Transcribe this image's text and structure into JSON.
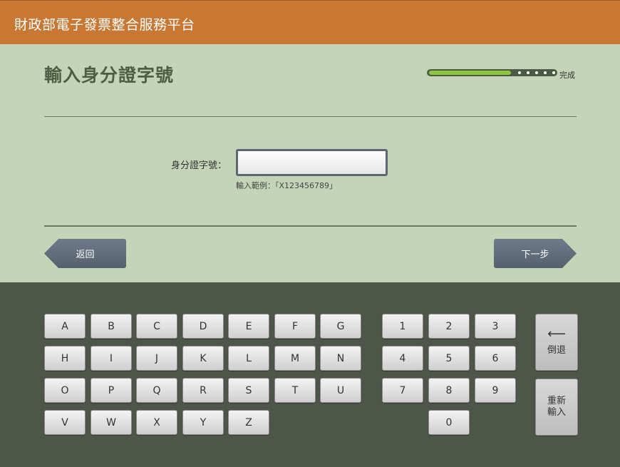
{
  "header": {
    "title": "財政部電子發票整合服務平台"
  },
  "page": {
    "title": "輸入身分證字號"
  },
  "progress": {
    "label": "完成",
    "fraction": 0.65
  },
  "form": {
    "id_label": "身分證字號：",
    "id_value": "",
    "id_placeholder": "",
    "hint": "輸入範例：「X123456789」"
  },
  "nav": {
    "back_label": "返回",
    "next_label": "下一步"
  },
  "keyboard": {
    "letters": [
      "A",
      "B",
      "C",
      "D",
      "E",
      "F",
      "G",
      "H",
      "I",
      "J",
      "K",
      "L",
      "M",
      "N",
      "O",
      "P",
      "Q",
      "R",
      "S",
      "T",
      "U",
      "V",
      "W",
      "X",
      "Y",
      "Z"
    ],
    "digits": [
      "1",
      "2",
      "3",
      "4",
      "5",
      "6",
      "7",
      "8",
      "9",
      "0"
    ],
    "backspace_arrow": "⟵",
    "backspace_label": "倒退",
    "reset_label_1": "重新",
    "reset_label_2": "輸入"
  }
}
